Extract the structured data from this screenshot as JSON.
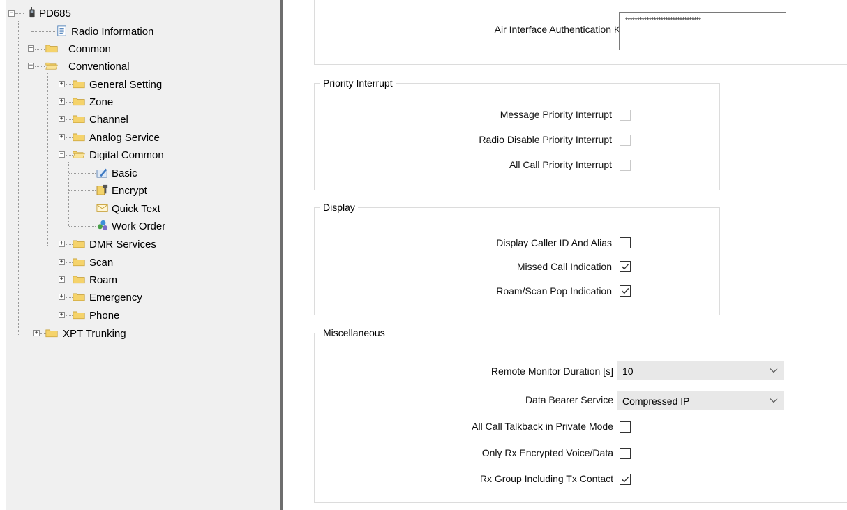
{
  "tree": {
    "root": {
      "label": "PD685",
      "expander": "−",
      "icon": "radio-device-icon"
    },
    "items": [
      {
        "label": "Radio Information",
        "icon": "document-list-icon"
      },
      {
        "label": "Common",
        "expander": "+",
        "icon": "folder-icon"
      },
      {
        "label": "Conventional",
        "expander": "−",
        "icon": "folder-open-icon"
      },
      {
        "label": "General Setting",
        "expander": "+",
        "icon": "folder-icon"
      },
      {
        "label": "Zone",
        "expander": "+",
        "icon": "folder-icon"
      },
      {
        "label": "Channel",
        "expander": "+",
        "icon": "folder-icon"
      },
      {
        "label": "Analog Service",
        "expander": "+",
        "icon": "folder-icon"
      },
      {
        "label": "Digital Common",
        "expander": "−",
        "icon": "folder-open-icon"
      },
      {
        "label": "Basic",
        "icon": "basic-settings-icon"
      },
      {
        "label": "Encrypt",
        "icon": "encrypt-icon"
      },
      {
        "label": "Quick Text",
        "icon": "envelope-icon"
      },
      {
        "label": "Work Order",
        "icon": "work-order-icon"
      },
      {
        "label": "DMR Services",
        "expander": "+",
        "icon": "folder-icon"
      },
      {
        "label": "Scan",
        "expander": "+",
        "icon": "folder-icon"
      },
      {
        "label": "Roam",
        "expander": "+",
        "icon": "folder-icon"
      },
      {
        "label": "Emergency",
        "expander": "+",
        "icon": "folder-icon"
      },
      {
        "label": "Phone",
        "expander": "+",
        "icon": "folder-icon"
      },
      {
        "label": "XPT Trunking",
        "expander": "+",
        "icon": "folder-icon"
      }
    ]
  },
  "air": {
    "label": "Air Interface Authentication Key",
    "value": "********************************"
  },
  "priority": {
    "title": "Priority Interrupt",
    "items": [
      {
        "label": "Message Priority Interrupt",
        "checked": false
      },
      {
        "label": "Radio Disable Priority Interrupt",
        "checked": false
      },
      {
        "label": "All Call Priority Interrupt",
        "checked": false
      }
    ]
  },
  "display": {
    "title": "Display",
    "items": [
      {
        "label": "Display Caller ID And Alias",
        "checked": false
      },
      {
        "label": "Missed Call Indication",
        "checked": true
      },
      {
        "label": "Roam/Scan Pop Indication",
        "checked": true
      }
    ]
  },
  "misc": {
    "title": "Miscellaneous",
    "remote_monitor": {
      "label": "Remote Monitor Duration [s]",
      "value": "10"
    },
    "data_bearer": {
      "label": "Data Bearer Service",
      "value": "Compressed IP"
    },
    "items": [
      {
        "label": "All Call Talkback in Private Mode",
        "checked": false
      },
      {
        "label": "Only Rx Encrypted Voice/Data",
        "checked": false
      },
      {
        "label": "Rx Group Including Tx Contact",
        "checked": true
      }
    ]
  },
  "colors": {
    "folder": "#f5d36b",
    "folder_border": "#c9a33a",
    "pane_bg": "#f0f0f0",
    "check": "#333333"
  }
}
